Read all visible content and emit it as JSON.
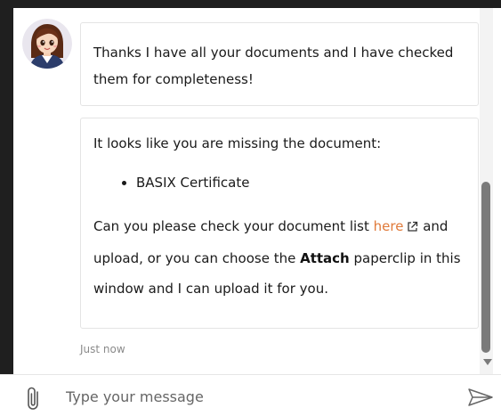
{
  "chat": {
    "message_1": "Thanks I have all your documents and I have checked them for completeness!",
    "message_2": {
      "intro": "It looks like you are missing the document:",
      "missing_items": [
        "BASIX Certificate"
      ],
      "text_before_link": "Can you please check your document list ",
      "link_text": "here",
      "text_after_link": " and upload, or you can choose the ",
      "bold_word": "Attach",
      "text_end": " paperclip in this window and I can upload it for you."
    },
    "timestamp": "Just now"
  },
  "input": {
    "placeholder": "Type your message"
  },
  "icons": {
    "attach": "paperclip-icon",
    "send": "send-icon",
    "external_link": "external-link-icon",
    "avatar": "assistant-avatar"
  },
  "colors": {
    "link": "#e07a3a",
    "frame": "#1f1f1f",
    "bubble_border": "#e4e4e4",
    "scrollbar_thumb": "#7a7a7a"
  }
}
